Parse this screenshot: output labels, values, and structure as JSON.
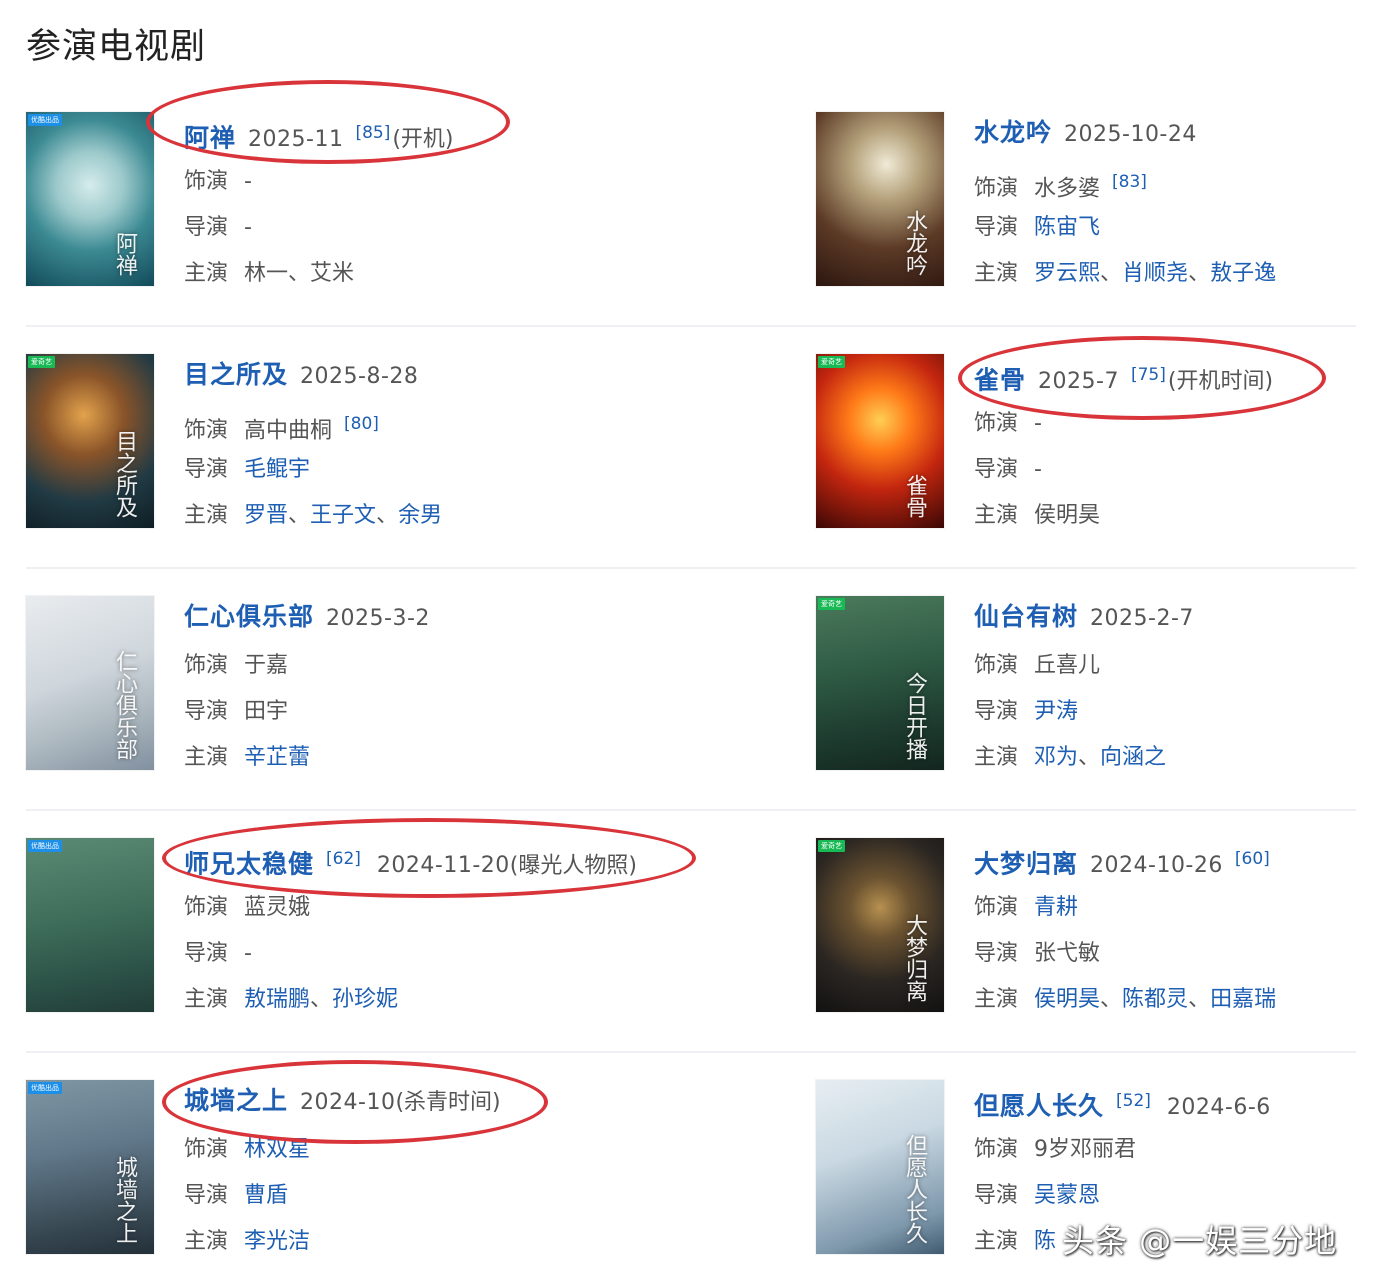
{
  "heading": "参演电视剧",
  "watermark": "头条 @一娱三分地",
  "colors": {
    "link": "#1e5fb3",
    "annotation": "#d8343a",
    "divider": "#eef0f3"
  },
  "labels": {
    "role": "饰演",
    "director": "导演",
    "cast": "主演"
  },
  "entries": [
    {
      "title": "阿禅",
      "date": "2025-11",
      "ref": "[85]",
      "note": "(开机)",
      "ref_after_title": false,
      "role": {
        "text": "-",
        "link": false
      },
      "director": [
        {
          "text": "-",
          "link": false
        }
      ],
      "cast": [
        {
          "text": "林一",
          "link": false
        },
        {
          "text": "艾米",
          "link": false
        }
      ],
      "poster": {
        "text": "阿禅",
        "badge": "优酷出品"
      },
      "circled": true
    },
    {
      "title": "水龙吟",
      "date": "2025-10-24",
      "ref": "",
      "note": "",
      "ref_after_title": false,
      "role": {
        "text": "水多婆",
        "link": false,
        "ref": "[83]"
      },
      "director": [
        {
          "text": "陈宙飞",
          "link": true
        }
      ],
      "cast": [
        {
          "text": "罗云熙",
          "link": true
        },
        {
          "text": "肖顺尧",
          "link": true
        },
        {
          "text": "敖子逸",
          "link": true
        }
      ],
      "poster": {
        "text": "水龙吟",
        "badge": ""
      },
      "circled": false
    },
    {
      "title": "目之所及",
      "date": "2025-8-28",
      "ref": "",
      "note": "",
      "ref_after_title": false,
      "role": {
        "text": "高中曲桐",
        "link": false,
        "ref": "[80]"
      },
      "director": [
        {
          "text": "毛鲲宇",
          "link": true
        }
      ],
      "cast": [
        {
          "text": "罗晋",
          "link": true
        },
        {
          "text": "王子文",
          "link": true
        },
        {
          "text": "余男",
          "link": true
        }
      ],
      "poster": {
        "text": "目之所及",
        "badge": "爱奇艺"
      },
      "circled": false
    },
    {
      "title": "雀骨",
      "date": "2025-7",
      "ref": "[75]",
      "note": "(开机时间)",
      "ref_after_title": false,
      "role": {
        "text": "-",
        "link": false
      },
      "director": [
        {
          "text": "-",
          "link": false
        }
      ],
      "cast": [
        {
          "text": "侯明昊",
          "link": false
        }
      ],
      "poster": {
        "text": "雀骨",
        "badge": "爱奇艺"
      },
      "circled": true
    },
    {
      "title": "仁心俱乐部",
      "date": "2025-3-2",
      "ref": "",
      "note": "",
      "ref_after_title": false,
      "role": {
        "text": "于嘉",
        "link": false
      },
      "director": [
        {
          "text": "田宇",
          "link": false
        }
      ],
      "cast": [
        {
          "text": "辛芷蕾",
          "link": true
        }
      ],
      "poster": {
        "text": "仁心俱乐部",
        "badge": ""
      },
      "circled": false
    },
    {
      "title": "仙台有树",
      "date": "2025-2-7",
      "ref": "",
      "note": "",
      "ref_after_title": false,
      "role": {
        "text": "丘喜儿",
        "link": false
      },
      "director": [
        {
          "text": "尹涛",
          "link": true
        }
      ],
      "cast": [
        {
          "text": "邓为",
          "link": true
        },
        {
          "text": "向涵之",
          "link": true
        }
      ],
      "poster": {
        "text": "今日开播",
        "badge": "爱奇艺"
      },
      "circled": false
    },
    {
      "title": "师兄太稳健",
      "date": "2024-11-20",
      "ref": "[62]",
      "note": "(曝光人物照)",
      "ref_after_title": true,
      "role": {
        "text": "蓝灵娥",
        "link": false
      },
      "director": [
        {
          "text": "-",
          "link": false
        }
      ],
      "cast": [
        {
          "text": "敖瑞鹏",
          "link": true
        },
        {
          "text": "孙珍妮",
          "link": true
        }
      ],
      "poster": {
        "text": "",
        "badge": "优酷出品"
      },
      "circled": true
    },
    {
      "title": "大梦归离",
      "date": "2024-10-26",
      "ref": "[60]",
      "note": "",
      "ref_after_title": false,
      "role": {
        "text": "青耕",
        "link": true
      },
      "director": [
        {
          "text": "张弋敏",
          "link": false
        }
      ],
      "cast": [
        {
          "text": "侯明昊",
          "link": true
        },
        {
          "text": "陈都灵",
          "link": true
        },
        {
          "text": "田嘉瑞",
          "link": true
        }
      ],
      "poster": {
        "text": "大梦归离",
        "badge": "爱奇艺"
      },
      "circled": false
    },
    {
      "title": "城墙之上",
      "date": "2024-10",
      "ref": "",
      "note": "(杀青时间)",
      "ref_after_title": false,
      "role": {
        "text": "林双星",
        "link": true
      },
      "director": [
        {
          "text": "曹盾",
          "link": true
        }
      ],
      "cast": [
        {
          "text": "李光洁",
          "link": true
        }
      ],
      "poster": {
        "text": "城墙之上",
        "badge": "优酷出品"
      },
      "circled": true
    },
    {
      "title": "但愿人长久",
      "date": "2024-6-6",
      "ref": "[52]",
      "note": "",
      "ref_after_title": true,
      "role": {
        "text": "9岁邓丽君",
        "link": false
      },
      "director": [
        {
          "text": "吴蒙恩",
          "link": true
        }
      ],
      "cast": [
        {
          "text": "陈",
          "link": true
        }
      ],
      "poster": {
        "text": "但愿人长久",
        "badge": ""
      },
      "circled": false
    }
  ]
}
